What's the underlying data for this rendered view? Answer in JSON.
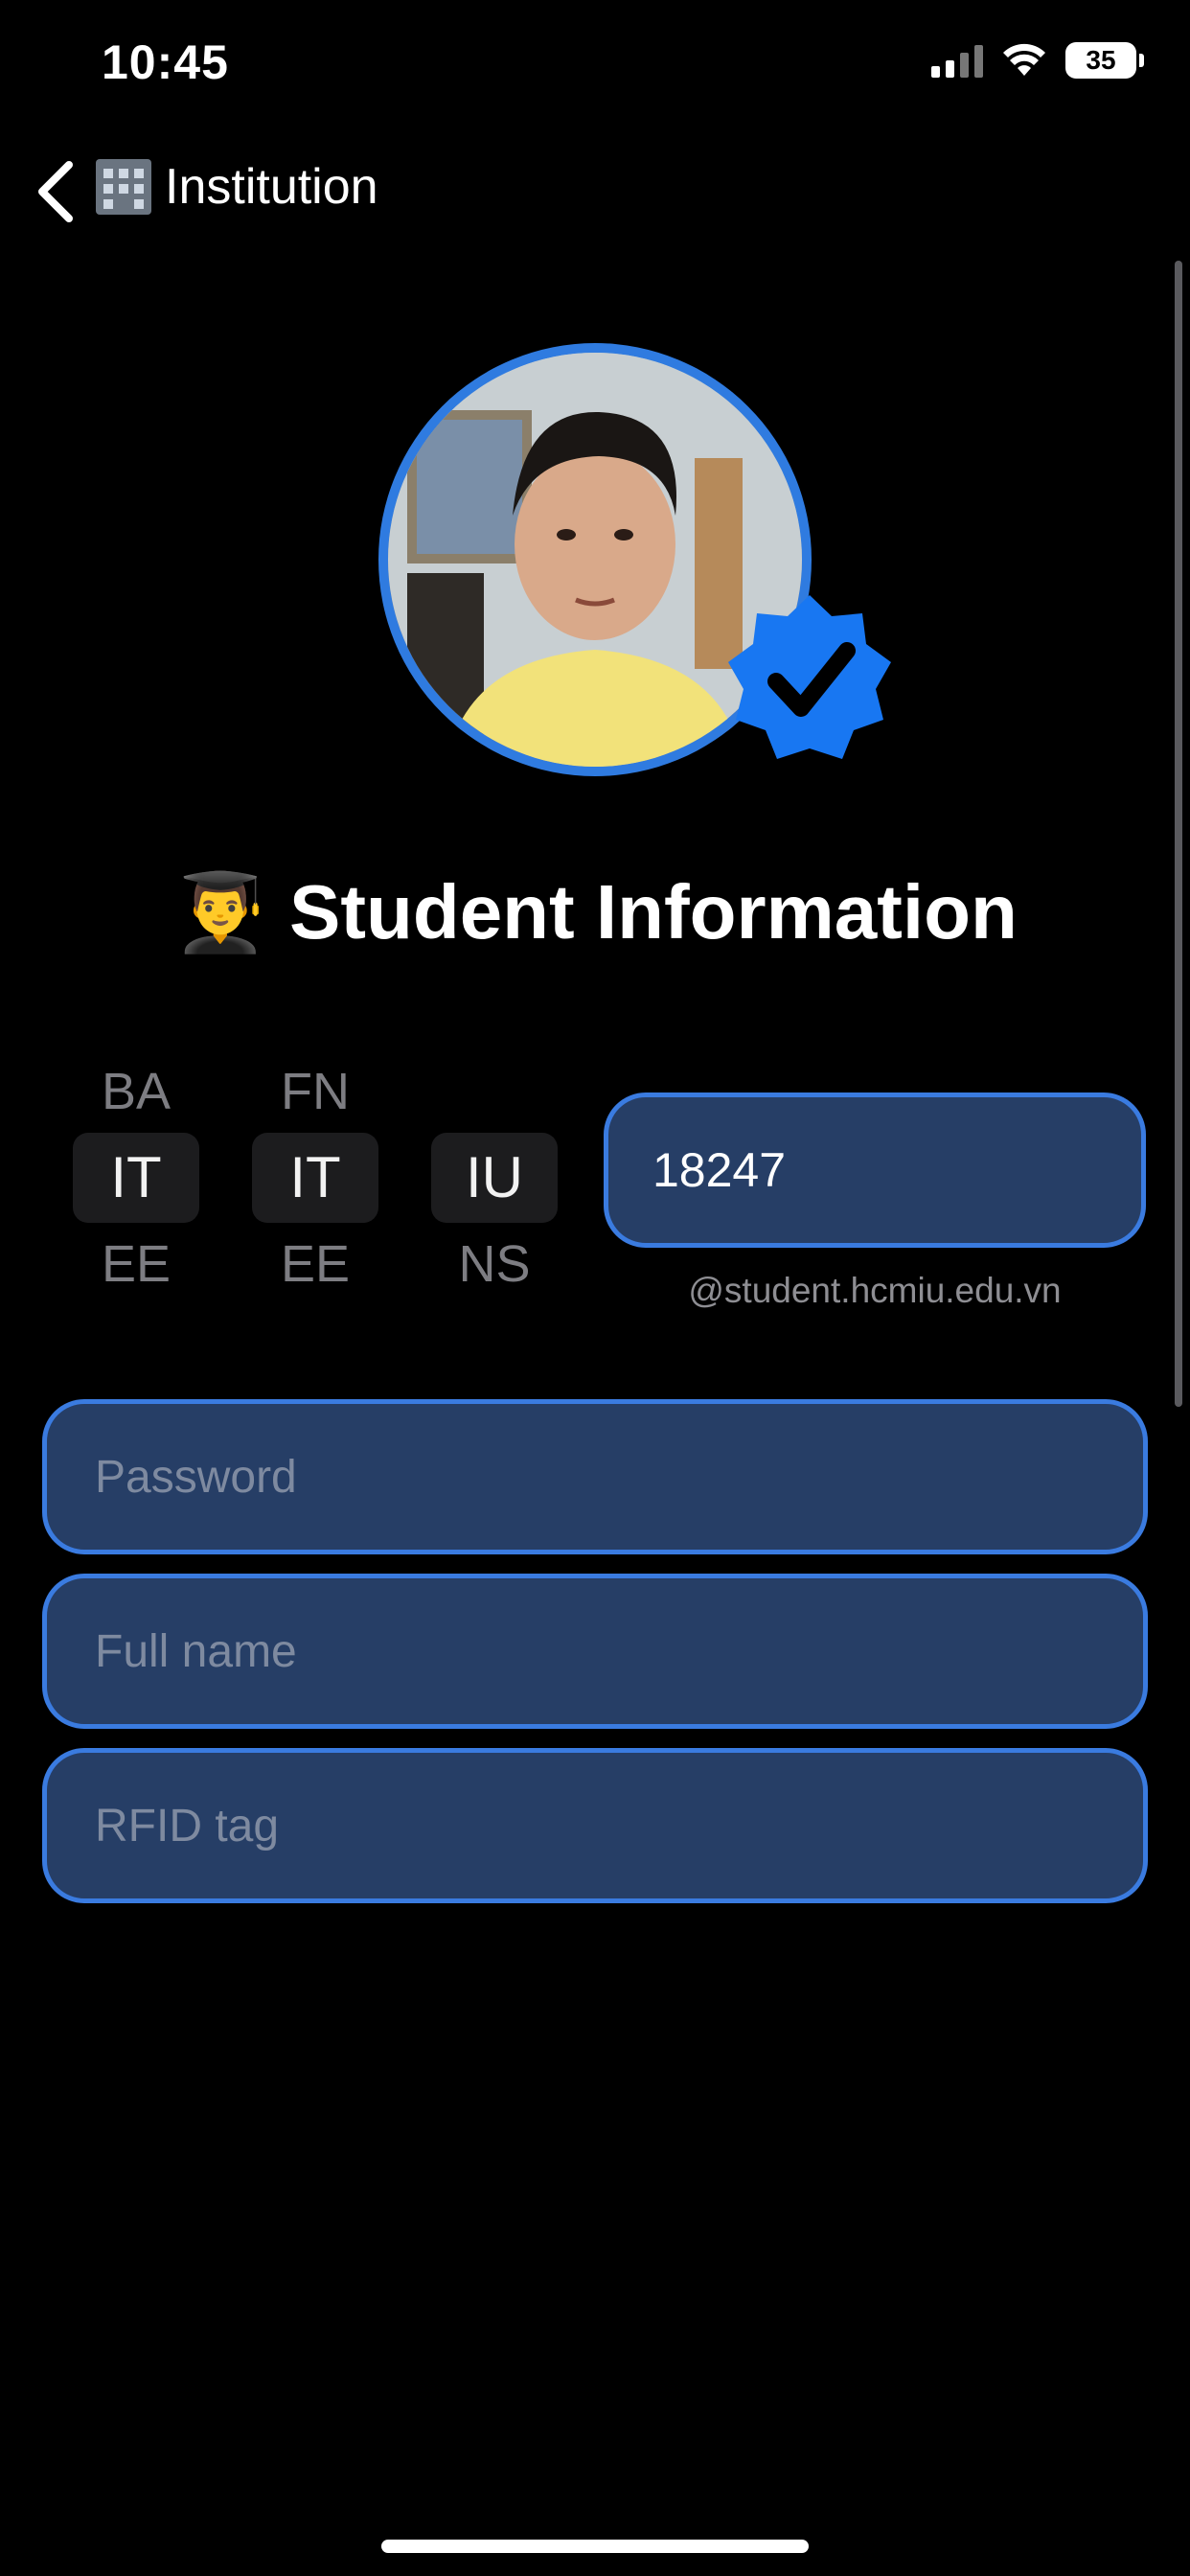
{
  "status_bar": {
    "time": "10:45",
    "battery": "35",
    "signal_icon": "cellular-signal-icon",
    "wifi_icon": "wifi-icon"
  },
  "nav": {
    "back_icon": "chevron-left-icon",
    "title_emoji_icon": "office-building-icon",
    "title": "Institution"
  },
  "profile": {
    "avatar": "student-photo",
    "verified_icon": "verified-badge-icon",
    "colors": {
      "ring": "#2f7be0",
      "badge": "#1877f2"
    }
  },
  "heading": {
    "emoji": "👨‍🎓",
    "text": "Student Information"
  },
  "pickers": [
    {
      "above": "BA",
      "selected": "IT",
      "below": "EE"
    },
    {
      "above": "FN",
      "selected": "IT",
      "below": "EE"
    },
    {
      "above": "",
      "selected": "IU",
      "below": "NS"
    }
  ],
  "student_id": {
    "value": "18247",
    "domain": "@student.hcmiu.edu.vn"
  },
  "fields": {
    "password_placeholder": "Password",
    "fullname_placeholder": "Full name",
    "rfid_placeholder": "RFID tag"
  },
  "theme": {
    "background": "#000000",
    "field_fill": "#263e66",
    "field_border": "#3a7be0",
    "placeholder": "#7e8aa0"
  }
}
